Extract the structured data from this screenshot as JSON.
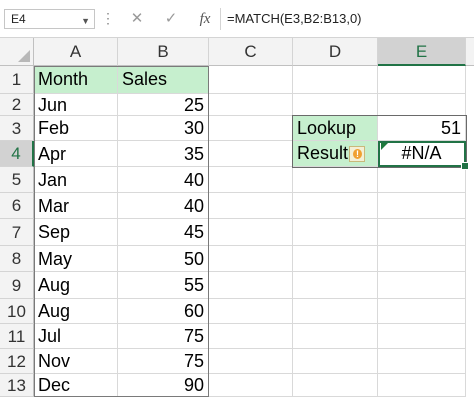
{
  "formula_bar": {
    "name_box": "E4",
    "cancel_icon": "✕",
    "enter_icon": "✓",
    "fx_label": "fx",
    "formula": "=MATCH(E3,B2:B13,0)"
  },
  "columns": [
    "A",
    "B",
    "C",
    "D",
    "E"
  ],
  "rows": [
    "1",
    "2",
    "3",
    "4",
    "5",
    "6",
    "7",
    "8",
    "9",
    "10",
    "11",
    "12",
    "13"
  ],
  "table": {
    "header_month": "Month",
    "header_sales": "Sales",
    "data": [
      {
        "month": "Jun",
        "sales": "25"
      },
      {
        "month": "Feb",
        "sales": "30"
      },
      {
        "month": "Apr",
        "sales": "35"
      },
      {
        "month": "Jan",
        "sales": "40"
      },
      {
        "month": "Mar",
        "sales": "40"
      },
      {
        "month": "Sep",
        "sales": "45"
      },
      {
        "month": "May",
        "sales": "50"
      },
      {
        "month": "Aug",
        "sales": "55"
      },
      {
        "month": "Aug",
        "sales": "60"
      },
      {
        "month": "Jul",
        "sales": "75"
      },
      {
        "month": "Nov",
        "sales": "75"
      },
      {
        "month": "Dec",
        "sales": "90"
      }
    ]
  },
  "lookup": {
    "label": "Lookup",
    "value": "51",
    "result_label": "Result",
    "result_value": "#N/A",
    "warning_icon": "!"
  },
  "colors": {
    "accent": "#217346",
    "header_fill": "#c6efce"
  }
}
